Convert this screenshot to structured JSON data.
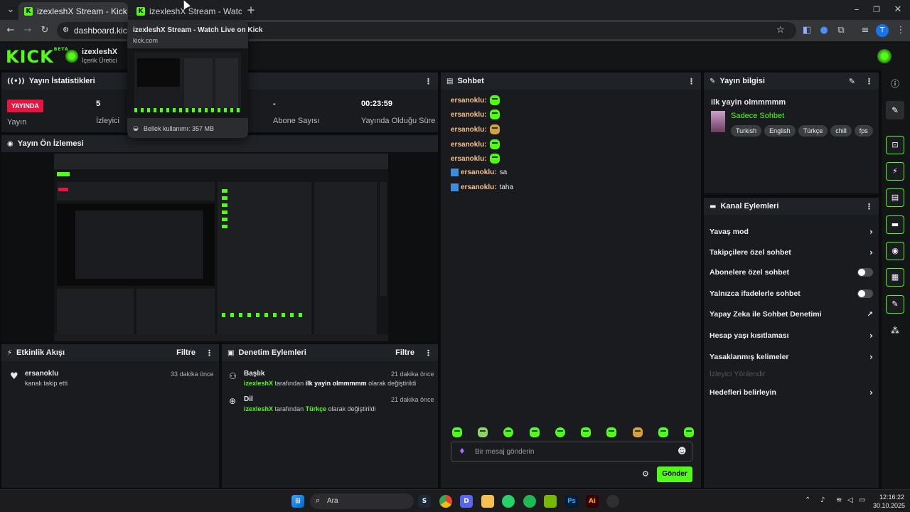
{
  "browser": {
    "tabs": [
      {
        "title": "izexleshX Stream - Kick Dashbo",
        "active": true
      },
      {
        "title": "izexleshX Stream - Watch Live o",
        "active": false
      }
    ],
    "new_tab": "+",
    "url": "dashboard.kick.co",
    "window_controls": {
      "minimize": "–",
      "restore": "❐",
      "close": "✕"
    },
    "profile_initial": "T"
  },
  "tooltip": {
    "title": "izexleshX Stream - Watch Live on Kick",
    "domain": "kick.com",
    "memory": "Bellek kullanımı: 357 MB"
  },
  "header": {
    "logo": "KICK",
    "logo_badge": "BETA",
    "channel_name": "izexleshX",
    "channel_role": "İçerik Üretici"
  },
  "stats": {
    "title": "Yayın İstatistikleri",
    "live_badge": "YAYINDA",
    "live_label": "Yayın",
    "viewers_value": "5",
    "viewers_label": "İzleyici",
    "subs_value": "-",
    "subs_label": "Abone Sayısı",
    "duration_value": "00:23:59",
    "duration_label": "Yayında Olduğu Süre"
  },
  "preview": {
    "title": "Yayın Ön İzlemesi"
  },
  "activity": {
    "title": "Etkinlik Akışı",
    "filter": "Filtre",
    "items": [
      {
        "user": "ersanoklu",
        "text": "kanalı takip etti",
        "time": "33 dakika önce"
      }
    ]
  },
  "moderation": {
    "title": "Denetim Eylemleri",
    "filter": "Filtre",
    "items": [
      {
        "label": "Başlık",
        "time": "21 dakika önce",
        "user": "izexleshX",
        "mid": "tarafından",
        "value": "ilk yayin olmmmmm",
        "end": "olarak değiştirildi"
      },
      {
        "label": "Dil",
        "time": "21 dakika önce",
        "user": "izexleshX",
        "mid": "tarafından",
        "value": "Türkçe",
        "end": "olarak değiştirildi"
      }
    ]
  },
  "chat": {
    "title": "Sohbet",
    "messages": [
      {
        "user": "ersanoklu:",
        "text": ""
      },
      {
        "user": "ersanoklu:",
        "text": ""
      },
      {
        "user": "ersanoklu:",
        "text": ""
      },
      {
        "user": "ersanoklu:",
        "text": ""
      },
      {
        "user": "ersanoklu:",
        "text": ""
      },
      {
        "user": "ersanoklu:",
        "text": "sa"
      },
      {
        "user": "ersanoklu:",
        "text": "taha"
      }
    ],
    "placeholder": "Bir mesaj gönderin",
    "send": "Gönder"
  },
  "stream_info": {
    "title": "Yayın bilgisi",
    "stream_title": "ilk yayin olmmmmm",
    "category": "Sadece Sohbet",
    "tags": [
      "Turkish",
      "English",
      "Türkçe",
      "chill",
      "fps"
    ]
  },
  "channel_actions": {
    "title": "Kanal Eylemleri",
    "items": [
      {
        "label": "Yavaş mod",
        "kind": "chevron"
      },
      {
        "label": "Takipçilere özel sohbet",
        "kind": "chevron"
      },
      {
        "label": "Abonelere özel sohbet",
        "kind": "toggle"
      },
      {
        "label": "Yalnızca ifadelerle sohbet",
        "kind": "toggle"
      },
      {
        "label": "Yapay Zeka ile Sohbet Denetimi",
        "kind": "external"
      },
      {
        "label": "Hesap yaşı kısıtlaması",
        "kind": "chevron"
      },
      {
        "label": "Yasaklanmış kelimeler",
        "kind": "chevron"
      },
      {
        "label": "İzleyici Yönlendir",
        "kind": "disabled"
      },
      {
        "label": "Hedefleri belirleyin",
        "kind": "chevron"
      }
    ]
  },
  "taskbar": {
    "search": "Ara",
    "time": "12:16:22",
    "date": "30.10.2025",
    "apps": [
      "windows",
      "search",
      "steam",
      "chrome",
      "discord",
      "files",
      "whatsapp",
      "spotify",
      "nvidia",
      "Ps",
      "Ai",
      "obs"
    ]
  },
  "colors": {
    "accent": "#53fc18",
    "live": "#e5153f",
    "panel": "#191b1f"
  }
}
